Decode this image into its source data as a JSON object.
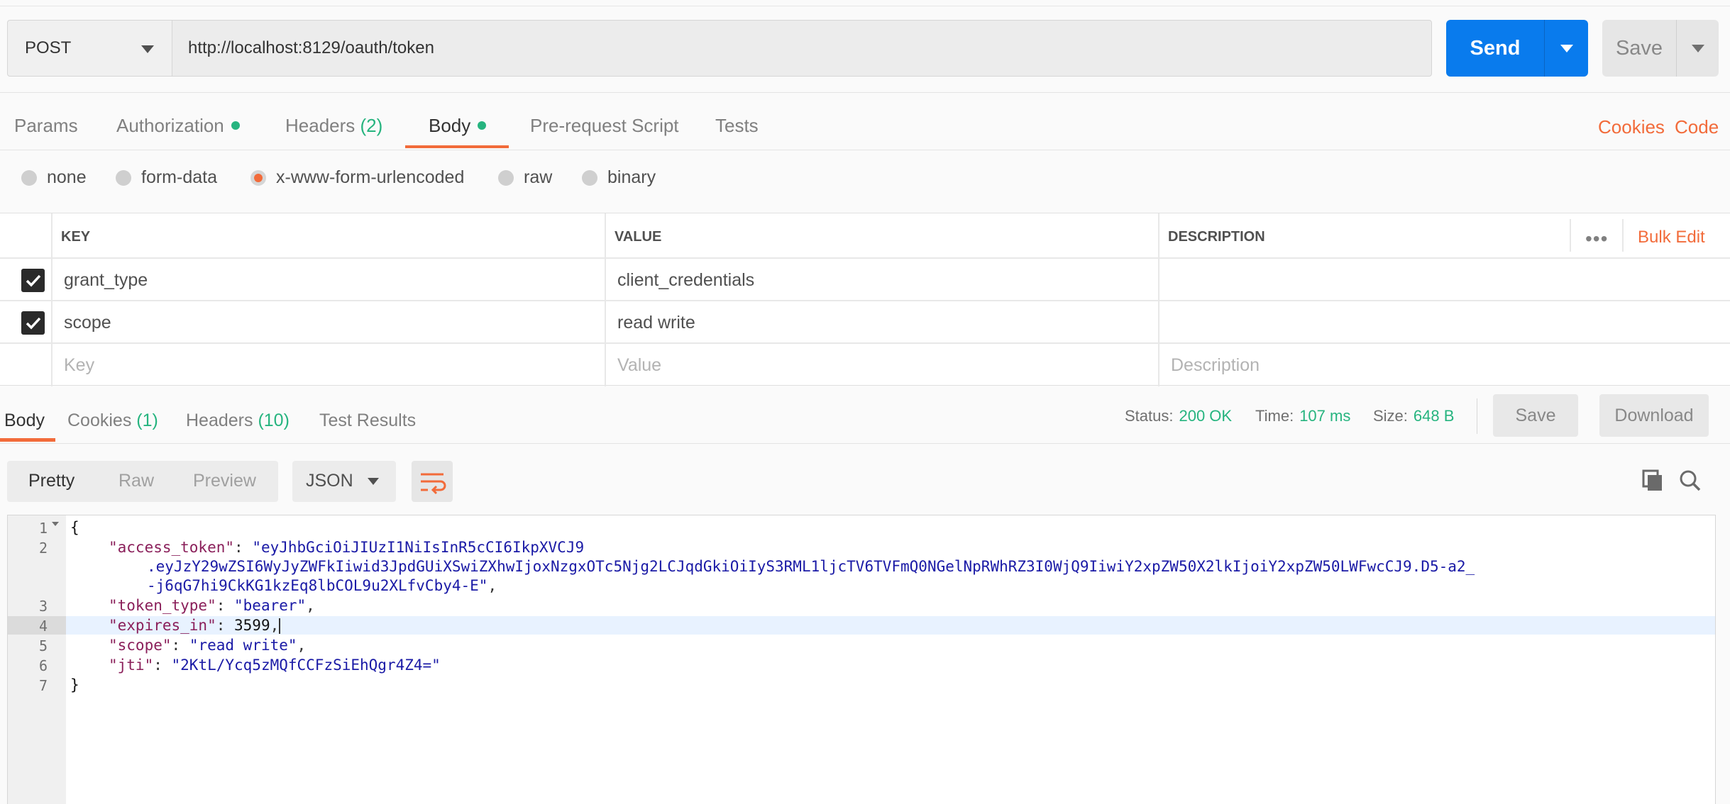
{
  "request": {
    "method": "POST",
    "url": "http://localhost:8129/oauth/token",
    "send_label": "Send",
    "save_label": "Save"
  },
  "request_tabs": [
    {
      "label": "Params",
      "count": "",
      "dot": false,
      "active": false
    },
    {
      "label": "Authorization",
      "count": "",
      "dot": true,
      "active": false
    },
    {
      "label": "Headers",
      "count": "(2)",
      "dot": false,
      "active": false
    },
    {
      "label": "Body",
      "count": "",
      "dot": true,
      "active": true
    },
    {
      "label": "Pre-request Script",
      "count": "",
      "dot": false,
      "active": false
    },
    {
      "label": "Tests",
      "count": "",
      "dot": false,
      "active": false
    }
  ],
  "links": {
    "cookies": "Cookies",
    "code": "Code"
  },
  "body_types": [
    {
      "label": "none",
      "selected": false
    },
    {
      "label": "form-data",
      "selected": false
    },
    {
      "label": "x-www-form-urlencoded",
      "selected": true
    },
    {
      "label": "raw",
      "selected": false
    },
    {
      "label": "binary",
      "selected": false
    }
  ],
  "params_table": {
    "headers": {
      "key": "KEY",
      "value": "VALUE",
      "description": "DESCRIPTION"
    },
    "more_icon": "ellipsis-icon",
    "bulk_edit": "Bulk Edit",
    "rows": [
      {
        "checked": true,
        "key": "grant_type",
        "value": "client_credentials",
        "description": ""
      },
      {
        "checked": true,
        "key": "scope",
        "value": "read write",
        "description": ""
      }
    ],
    "placeholders": {
      "key": "Key",
      "value": "Value",
      "description": "Description"
    }
  },
  "response_tabs": [
    {
      "label": "Body",
      "count": "",
      "active": true
    },
    {
      "label": "Cookies",
      "count": "(1)",
      "active": false
    },
    {
      "label": "Headers",
      "count": "(10)",
      "active": false
    },
    {
      "label": "Test Results",
      "count": "",
      "active": false
    }
  ],
  "response_status": {
    "status_label": "Status:",
    "status_value": "200 OK",
    "time_label": "Time:",
    "time_value": "107 ms",
    "size_label": "Size:",
    "size_value": "648 B",
    "save_label": "Save",
    "download_label": "Download"
  },
  "view_modes": [
    {
      "label": "Pretty",
      "active": true
    },
    {
      "label": "Raw",
      "active": false
    },
    {
      "label": "Preview",
      "active": false
    }
  ],
  "format": "JSON",
  "icons": {
    "wrap": "wrap-lines-icon",
    "copy": "copy-icon",
    "search": "search-icon"
  },
  "colors": {
    "accent": "#f26b3a",
    "primary": "#097bed",
    "success": "#26b47f"
  },
  "response_body": {
    "line_numbers": [
      "1",
      "2",
      "3",
      "4",
      "5",
      "6",
      "7"
    ],
    "open_brace": "{",
    "close_brace": "}",
    "access_token_key": "\"access_token\"",
    "access_token_value_1": "\"eyJhbGciOiJIUzI1NiIsInR5cCI6IkpXVCJ9",
    "access_token_value_2": ".eyJzY29wZSI6WyJyZWFkIiwid3JpdGUiXSwiZXhwIjoxNzgxOTc5Njg2LCJqdGkiOiIyS3RML1ljcTV6TVFmQ0NGelNpRWhRZ3I0WjQ9IiwiY2xpZW50X2lkIjoiY2xpZW50LWFwcCJ9.D5-a2_",
    "access_token_value_3": "-j6qG7hi9CkKG1kzEq8lbCOL9u2XLfvCby4-E\"",
    "token_type_key": "\"token_type\"",
    "token_type_value": "\"bearer\"",
    "expires_in_key": "\"expires_in\"",
    "expires_in_value": "3599",
    "scope_key": "\"scope\"",
    "scope_value": "\"read write\"",
    "jti_key": "\"jti\"",
    "jti_value": "\"2KtL/Ycq5zMQfCCFzSiEhQgr4Z4=\""
  }
}
